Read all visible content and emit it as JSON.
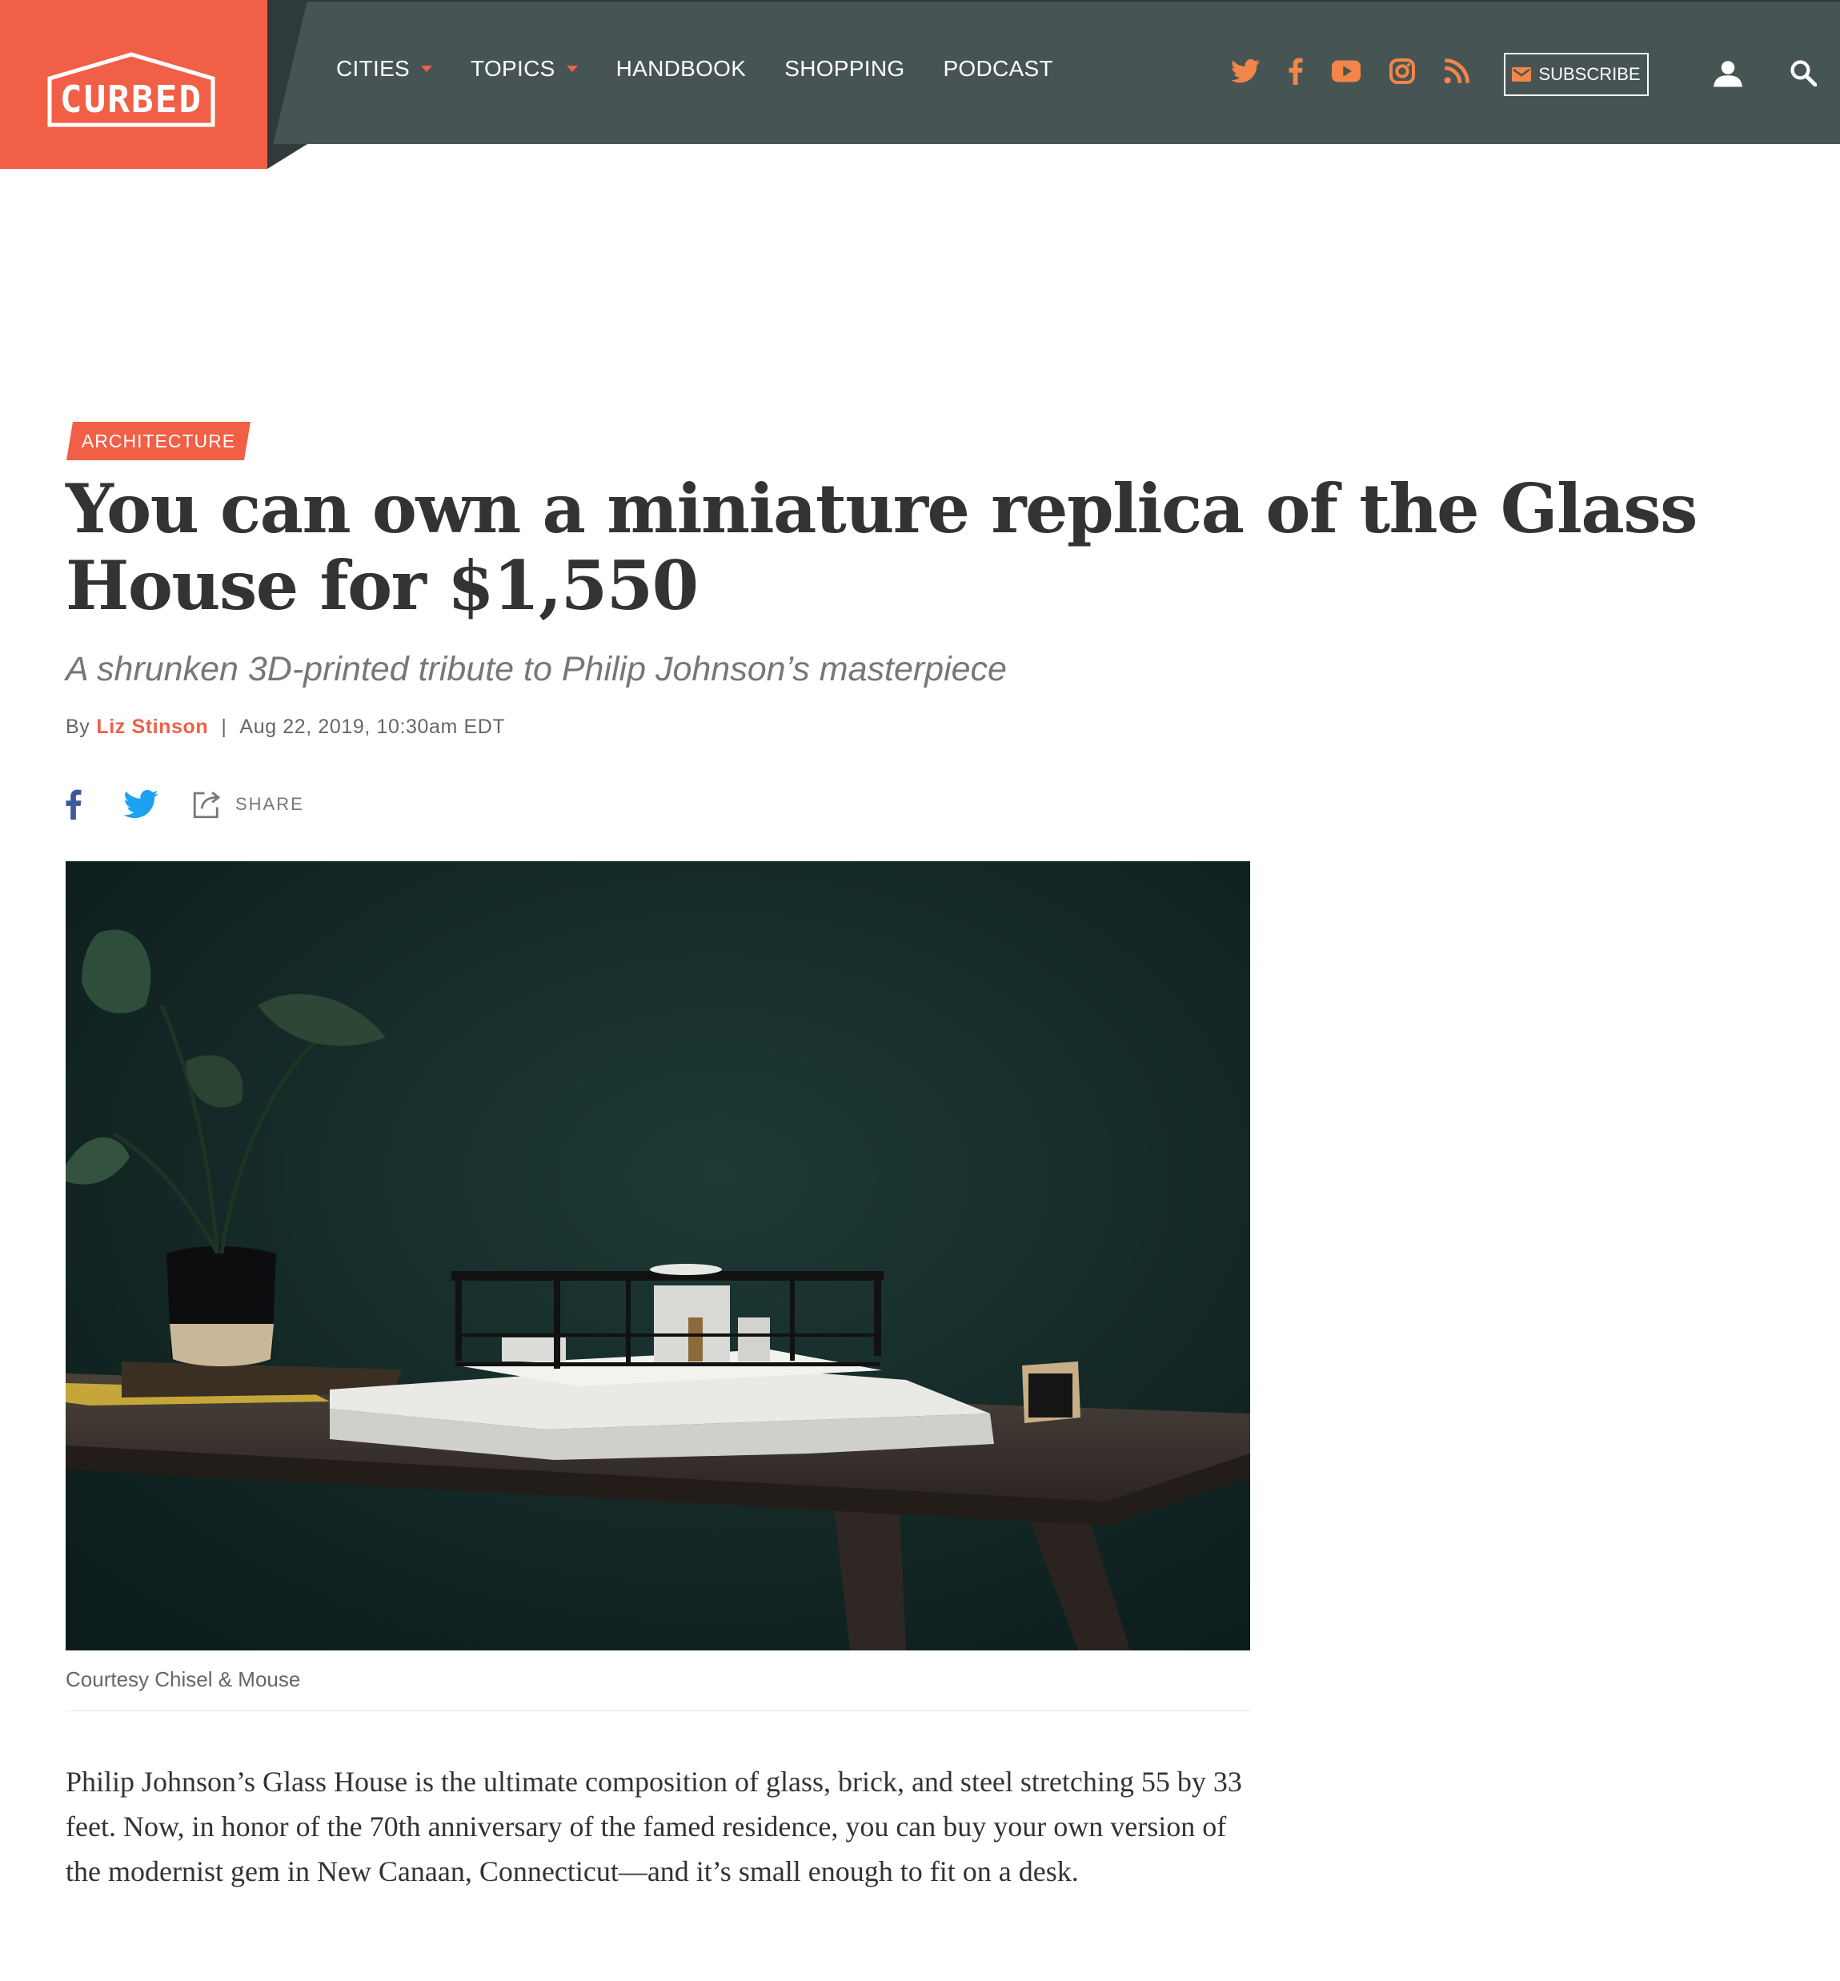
{
  "site": {
    "brand": "CURBED",
    "brand_color": "#f15f46",
    "header_color": "#475454"
  },
  "nav": {
    "items": [
      {
        "label": "CITIES",
        "has_dropdown": true
      },
      {
        "label": "TOPICS",
        "has_dropdown": true
      },
      {
        "label": "HANDBOOK",
        "has_dropdown": false
      },
      {
        "label": "SHOPPING",
        "has_dropdown": false
      },
      {
        "label": "PODCAST",
        "has_dropdown": false
      }
    ],
    "social_icons": [
      "twitter-icon",
      "facebook-icon",
      "youtube-icon",
      "instagram-icon",
      "rss-icon"
    ],
    "subscribe_label": "SUBSCRIBE"
  },
  "article": {
    "section": "ARCHITECTURE",
    "headline": "You can own a miniature replica of the Glass House for $1,550",
    "dek": "A shrunken 3D-printed tribute to Philip Johnson’s masterpiece",
    "byline_prefix": "By",
    "author": "Liz Stinson",
    "byline_separator": "|",
    "date": "Aug 22, 2019, 10:30am EDT",
    "share_label": "SHARE",
    "image_caption": "Courtesy Chisel & Mouse",
    "body": "Philip Johnson’s Glass House is the ultimate composition of glass, brick, and steel stretching 55 by 33 feet. Now, in honor of the 70th anniversary of the famed residence, you can buy your own version of the modernist gem in New Canaan, Connecticut—and it’s small enough to fit on a desk."
  }
}
